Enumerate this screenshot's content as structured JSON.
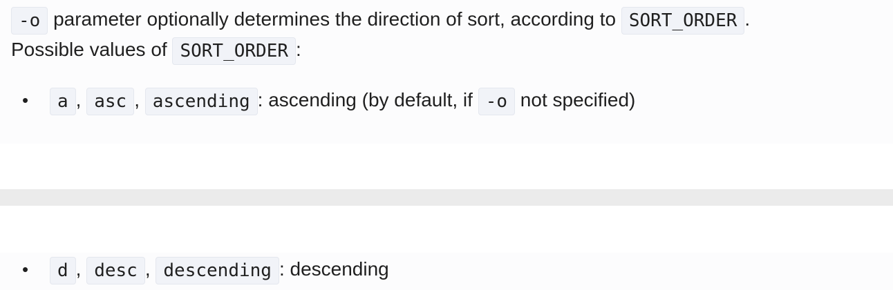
{
  "intro": {
    "code_flag": "-o",
    "text_1": " parameter optionally determines the direction of sort, according to ",
    "code_sort_order": "SORT_ORDER",
    "text_2": "."
  },
  "values_line": {
    "text": "Possible values of ",
    "code_sort_order": "SORT_ORDER",
    "text_after": ":"
  },
  "ascending_item": {
    "bullet": "•",
    "code_a": "a",
    "sep_1": ", ",
    "code_asc": "asc",
    "sep_2": ", ",
    "code_ascending": "ascending",
    "text_1": ": ascending (by default, if ",
    "code_flag": "-o",
    "text_2": " not specified)"
  },
  "descending_item": {
    "bullet": "•",
    "code_d": "d",
    "sep_1": ", ",
    "code_desc": "desc",
    "sep_2": ", ",
    "code_descending": "descending",
    "text_1": ": descending"
  }
}
